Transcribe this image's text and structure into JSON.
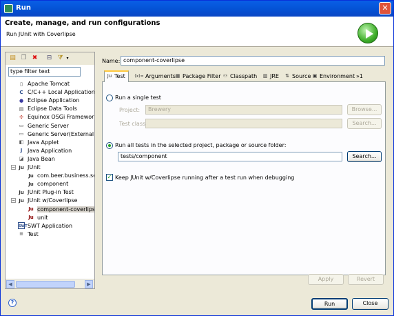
{
  "window": {
    "title": "Run",
    "close_glyph": "✕"
  },
  "header": {
    "title": "Create, manage, and run configurations",
    "subtitle": "Run JUnit with Coverlipse"
  },
  "toolbar": {
    "icons": [
      "new-launch-config-icon",
      "duplicate-icon",
      "delete-icon",
      "collapse-all-icon",
      "filter-icon"
    ]
  },
  "filter": {
    "value": "type filter text"
  },
  "tree": [
    {
      "label": "Apache Tomcat",
      "icon": "tomcat-icon",
      "glyph": "▯",
      "indent": 1
    },
    {
      "label": "C/C++ Local Application",
      "icon": "c-app-icon",
      "glyph": "C",
      "indent": 1
    },
    {
      "label": "Eclipse Application",
      "icon": "eclipse-icon",
      "glyph": "●",
      "indent": 1
    },
    {
      "label": "Eclipse Data Tools",
      "icon": "data-tools-icon",
      "glyph": "▤",
      "indent": 1
    },
    {
      "label": "Equinox OSGi Framework",
      "icon": "osgi-icon",
      "glyph": "✣",
      "indent": 1
    },
    {
      "label": "Generic Server",
      "icon": "server-icon",
      "glyph": "▭",
      "indent": 1
    },
    {
      "label": "Generic Server(External La",
      "icon": "server-icon",
      "glyph": "▭",
      "indent": 1
    },
    {
      "label": "Java Applet",
      "icon": "applet-icon",
      "glyph": "◧",
      "indent": 1
    },
    {
      "label": "Java Application",
      "icon": "java-app-icon",
      "glyph": "J",
      "indent": 1
    },
    {
      "label": "Java Bean",
      "icon": "java-bean-icon",
      "glyph": "◪",
      "indent": 1
    },
    {
      "label": "JUnit",
      "icon": "junit-icon",
      "glyph": "Ju",
      "indent": 1,
      "expander": "−"
    },
    {
      "label": "com.beer.business.ser",
      "icon": "junit-test-icon",
      "glyph": "Ju",
      "indent": 2
    },
    {
      "label": "component",
      "icon": "junit-test-icon",
      "glyph": "Ju",
      "indent": 2
    },
    {
      "label": "JUnit Plug-in Test",
      "icon": "junit-plugin-icon",
      "glyph": "Ju",
      "indent": 1
    },
    {
      "label": "JUnit w/Coverlipse",
      "icon": "coverlipse-icon",
      "glyph": "Ju",
      "indent": 1,
      "expander": "−"
    },
    {
      "label": "component-coverlipse",
      "icon": "coverlipse-test-icon",
      "glyph": "Ju",
      "indent": 2,
      "selected": true
    },
    {
      "label": "unit",
      "icon": "coverlipse-test-icon",
      "glyph": "Ju",
      "indent": 2
    },
    {
      "label": "SWT Application",
      "icon": "swt-icon",
      "glyph": "SWT",
      "indent": 1
    },
    {
      "label": "Test",
      "icon": "test-icon",
      "glyph": "≡",
      "indent": 1
    }
  ],
  "name": {
    "label": "Name:",
    "value": "component-coverlipse"
  },
  "tabs": [
    {
      "label": "Test",
      "icon": "test-tab-icon",
      "glyph": "Ju",
      "active": true
    },
    {
      "label": "Arguments",
      "icon": "arguments-icon",
      "glyph": "(x)="
    },
    {
      "label": "Package Filter",
      "icon": "package-icon",
      "glyph": "▦"
    },
    {
      "label": "Classpath",
      "icon": "classpath-icon",
      "glyph": "⚇"
    },
    {
      "label": "JRE",
      "icon": "jre-icon",
      "glyph": "▥"
    },
    {
      "label": "Source",
      "icon": "source-icon",
      "glyph": "⇅"
    },
    {
      "label": "Environment",
      "icon": "environment-icon",
      "glyph": "▣"
    },
    {
      "label": "»1",
      "icon": "more-tabs-icon",
      "glyph": ""
    }
  ],
  "test_tab": {
    "single_test_label": "Run a single test",
    "project_label": "Project:",
    "project_value": "Brewery",
    "browse_label": "Browse...",
    "test_class_label": "Test class:",
    "test_class_value": "",
    "search1_label": "Search...",
    "run_all_label": "Run all tests in the selected project, package or source folder:",
    "folder_value": "tests/component",
    "search2_label": "Search...",
    "keep_label": "Keep JUnit w/Coverlipse running after a test run when debugging",
    "keep_checked": true,
    "keep_check_glyph": "✓"
  },
  "apply_label": "Apply",
  "revert_label": "Revert",
  "footer": {
    "help_glyph": "?",
    "run_label": "Run",
    "close_label": "Close"
  }
}
